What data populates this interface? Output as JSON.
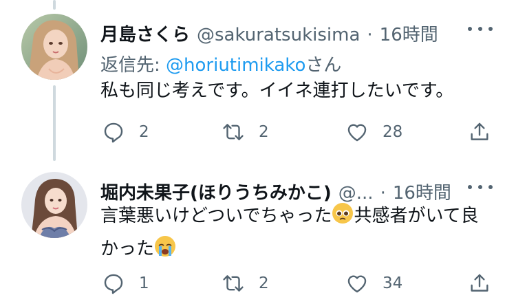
{
  "tweets": [
    {
      "display_name": "月島さくら",
      "handle": "@sakuratsukisima",
      "separator": "·",
      "time": "16時間",
      "reply_prefix": "返信先: ",
      "reply_mention": "@horiutimikako",
      "reply_suffix": "さん",
      "text": "私も同じ考えです。イイネ連打したいです。",
      "actions": {
        "replies": "2",
        "retweets": "2",
        "likes": "28"
      }
    },
    {
      "display_name": "堀内未果子(ほりうちみかこ)",
      "handle": "@...",
      "separator": "·",
      "time": "16時間",
      "text_line1": "言葉悪いけどついでちゃった",
      "text_line1_after": "共感者がいて良",
      "text_line2": "かった",
      "actions": {
        "replies": "1",
        "retweets": "2",
        "likes": "34"
      }
    }
  ],
  "icons": {
    "reply": "comment-bubble-icon",
    "retweet": "retweet-icon",
    "like": "heart-icon",
    "share": "share-icon",
    "more": "more-horizontal-icon",
    "emoji_1": "pleading-face-emoji",
    "emoji_2": "loudly-crying-face-emoji"
  },
  "colors": {
    "text": "#0f1419",
    "secondary": "#536471",
    "link": "#1d9bf0",
    "thread_line": "#cfd9de"
  }
}
